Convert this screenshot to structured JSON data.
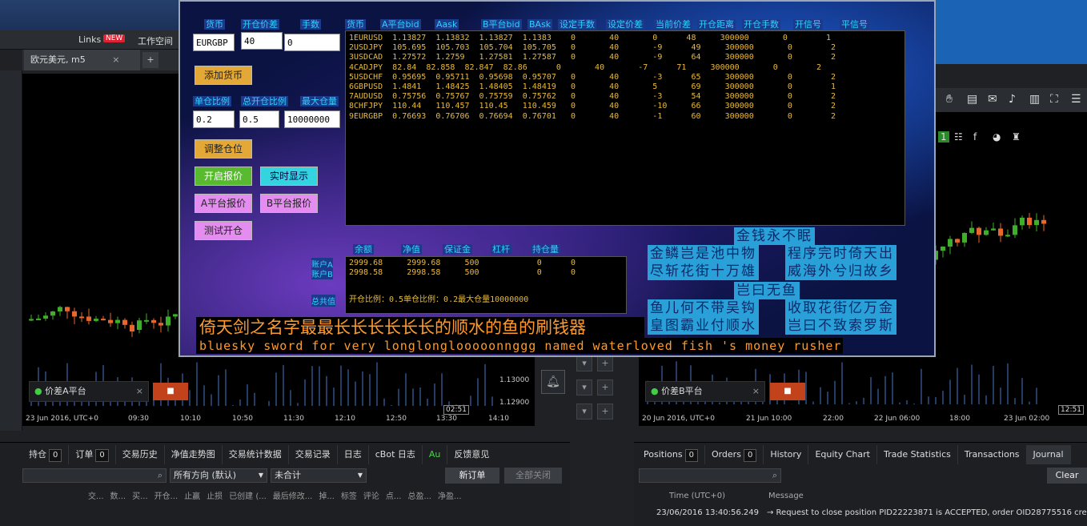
{
  "left_platform": {
    "links_label": "Links",
    "new_badge": "NEW",
    "workspace_label": "工作空间",
    "chart_tab": "欧元美元, m5",
    "strategy_name": "价差A平台",
    "price_ticks": [
      "1.13000",
      "1.12900"
    ],
    "time_labels": [
      "23 Jun 2016, UTC+0",
      "09:30",
      "10:10",
      "10:50",
      "11:30",
      "12:10",
      "12:50",
      "13:30",
      "14:10"
    ],
    "cursor_time": "02:51",
    "bottom_tabs": [
      {
        "label": "持仓",
        "count": "0"
      },
      {
        "label": "订单",
        "count": "0"
      },
      {
        "label": "交易历史"
      },
      {
        "label": "净值走势图"
      },
      {
        "label": "交易统计数据"
      },
      {
        "label": "交易记录"
      },
      {
        "label": "日志"
      },
      {
        "label": "cBot 日志"
      },
      {
        "label": "Au"
      },
      {
        "label": "反馈意见"
      }
    ],
    "direction_select": "所有方向 (默认)",
    "total_select": "未合计",
    "new_order_btn": "新订单",
    "close_all_btn": "全部关闭",
    "columns": [
      "交...",
      "数...",
      "买...",
      "开仓...",
      "止赢",
      "止损",
      "已创建 (...",
      "最后修改...",
      "掉...",
      "标签",
      "评论",
      "点...",
      "总盈...",
      "净盈..."
    ]
  },
  "right_platform": {
    "strategy_name": "价差B平台",
    "time_labels": [
      "20 Jun 2016, UTC+0",
      "21 Jun 10:00",
      "22:00",
      "22 Jun 06:00",
      "18:00",
      "23 Jun 02:00"
    ],
    "cursor_time": "12:51",
    "bottom_tabs": [
      {
        "label": "Positions",
        "count": "0"
      },
      {
        "label": "Orders",
        "count": "0"
      },
      {
        "label": "History"
      },
      {
        "label": "Equity Chart"
      },
      {
        "label": "Trade Statistics"
      },
      {
        "label": "Transactions"
      },
      {
        "label": "Journal"
      }
    ],
    "clear_btn": "Clear",
    "journal_cols": [
      "Time (UTC+0)",
      "Message"
    ],
    "journal_time": "23/06/2016 13:40:56.249",
    "journal_msg": "→ Request to close position PID22223871 is ACCEPTED, order OID28775516 create"
  },
  "ea": {
    "top_headers": [
      "货币",
      "开仓价差",
      "手数"
    ],
    "table_headers": [
      "货币",
      "A平台bid",
      "Aask",
      "B平台bid",
      "BAsk",
      "设定手数",
      "设定价差",
      "当前价差",
      "开仓距离",
      "开仓手数",
      "开信号",
      "平信号"
    ],
    "input_symbol": "EURGBP",
    "input_spread": "40",
    "input_lots": "0",
    "add_currency_btn": "添加货币",
    "ratio_headers": [
      "单仓比例",
      "总开仓比例",
      "最大仓量"
    ],
    "input_single_ratio": "0.2",
    "input_total_ratio": "0.5",
    "input_max_volume": "10000000",
    "adjust_btn": "调整仓位",
    "start_quote_btn": "开启报价",
    "realtime_btn": "实时显示",
    "a_quote_btn": "A平台报价",
    "b_quote_btn": "B平台报价",
    "test_open_btn": "测试开仓",
    "quote_rows": [
      "1EURUSD  1.13827  1.13832  1.13827  1.1383    0       40       0      48     300000       0        1",
      "2USDJPY  105.695  105.703  105.704  105.705   0       40       -9      49     300000       0        2",
      "3USDCAD  1.27572  1.2759   1.27581  1.27587   0       40       -9      64     300000       0        2",
      "4CADJPY  82.84  82.858  82.847  82.86      0       40       -7      71     300000       0        2",
      "5USDCHF  0.95695  0.95711  0.95698  0.95707   0       40       -3      65     300000       0        2",
      "6GBPUSD  1.4841   1.48425  1.48405  1.48419   0       40       5       69     300000       0        1",
      "7AUDUSD  0.75756  0.75767  0.75759  0.75762   0       40       -3      54     300000       0        2",
      "8CHFJPY  110.44   110.457  110.45   110.459   0       40       -10     66     300000       0        2",
      "9EURGBP  0.76693  0.76706  0.76694  0.76701   0       40       -1      60     300000       0        2"
    ],
    "acct_headers": [
      "余额",
      "净值",
      "保证金",
      "杠杆",
      "持仓量"
    ],
    "acct_labels": [
      "账户A",
      "账户B",
      "总共值"
    ],
    "acct_rows": [
      "2999.68     2999.68     500            0      0",
      "2998.58     2998.58     500            0      0"
    ],
    "ratio_summary": "开仓比例：0.5单仓比例：0.2最大仓量10000000",
    "poem": [
      "金钱永不眠",
      "金鳞岂是池中物",
      "程序完时倚天出",
      "尽斩花街十万雄",
      "威海外兮归故乡",
      "岂曰无鱼",
      "鱼儿何不带吴钩",
      "收取花街亿万金",
      "皇图霸业付顺水",
      "岂曰不致索罗斯"
    ],
    "title_cn": "倚天剑之名字最最长长长长长长的顺水的鱼的刷钱器",
    "title_en": "bluesky sword for very longlonglooooonnggg named waterloved fish 's money rusher"
  },
  "colors": {
    "ea_label": "#2fd0ff",
    "quote_text": "#e9bb3a",
    "title_text": "#ff9a2a",
    "bull_candle": "#3fae2a",
    "bear_candle": "#e8672c"
  }
}
